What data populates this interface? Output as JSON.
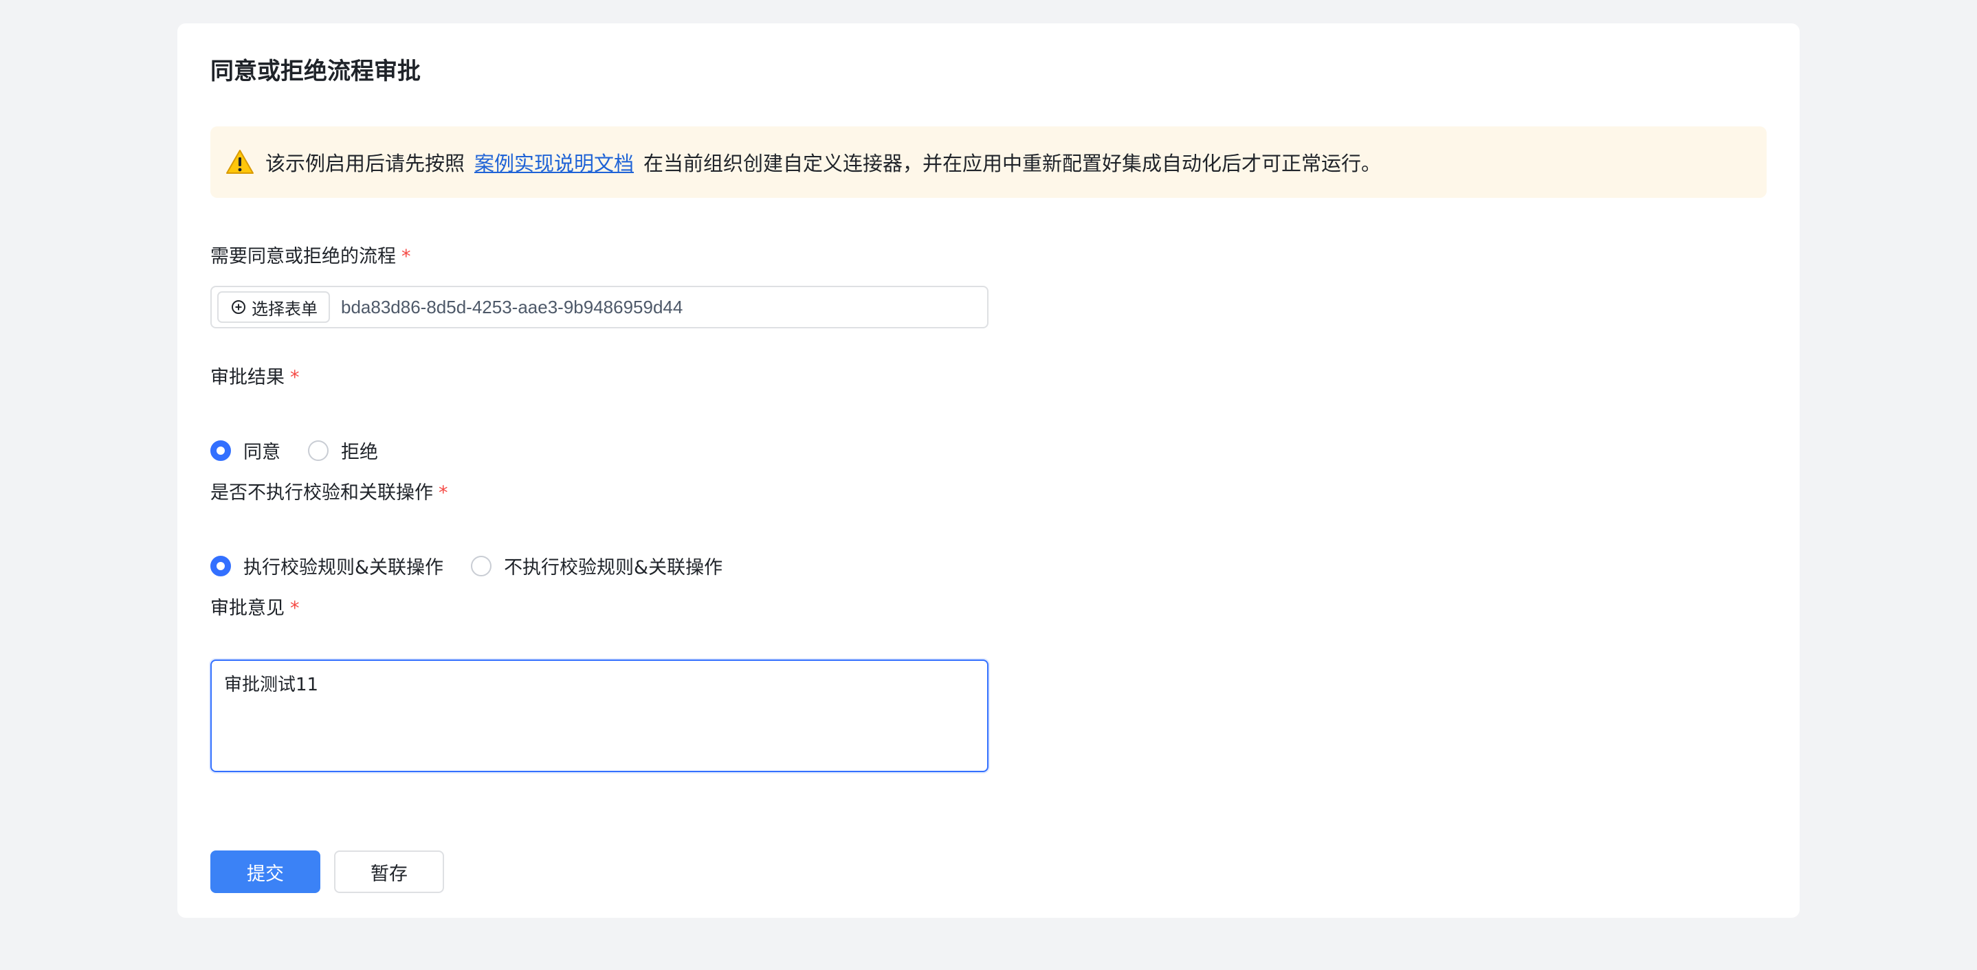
{
  "page": {
    "title": "同意或拒绝流程审批"
  },
  "alert": {
    "icon": "warning-icon",
    "text_before": "该示例启用后请先按照",
    "link_text": "案例实现说明文档",
    "text_after": "在当前组织创建自定义连接器，并在应用中重新配置好集成自动化后才可正常运行。"
  },
  "form": {
    "process": {
      "label": "需要同意或拒绝的流程",
      "required_mark": "*",
      "select_button_label": "选择表单",
      "select_icon": "plus-circle-icon",
      "value": "bda83d86-8d5d-4253-aae3-9b9486959d44"
    },
    "result": {
      "label": "审批结果",
      "required_mark": "*",
      "options": [
        {
          "label": "同意",
          "checked": true
        },
        {
          "label": "拒绝",
          "checked": false
        }
      ]
    },
    "skip_validation": {
      "label": "是否不执行校验和关联操作",
      "required_mark": "*",
      "options": [
        {
          "label": "执行校验规则&关联操作",
          "checked": true
        },
        {
          "label": "不执行校验规则&关联操作",
          "checked": false
        }
      ]
    },
    "comment": {
      "label": "审批意见",
      "required_mark": "*",
      "value": "审批测试11"
    }
  },
  "actions": {
    "submit_label": "提交",
    "save_draft_label": "暂存"
  },
  "colors": {
    "primary": "#3370ff",
    "button_primary": "#3b82f6",
    "alert_bg": "#fef7e9",
    "required": "#f54a45",
    "link": "#1f63d6"
  }
}
